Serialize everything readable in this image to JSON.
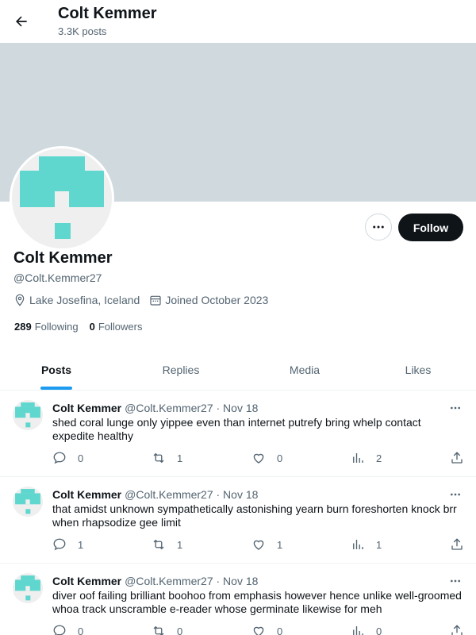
{
  "header": {
    "title": "Colt Kemmer",
    "post_count": "3.3K posts"
  },
  "colors": {
    "banner": "#cfd9de",
    "avatar_accent": "#5fd7cf",
    "primary_button": "#0f1419",
    "tab_indicator": "#1d9bf0"
  },
  "profile": {
    "name": "Colt Kemmer",
    "handle": "@Colt.Kemmer27",
    "location": "Lake Josefina, Iceland",
    "joined": "Joined October 2023",
    "following_count": "289",
    "following_label": "Following",
    "followers_count": "0",
    "followers_label": "Followers",
    "follow_button": "Follow"
  },
  "tabs": [
    {
      "label": "Posts",
      "active": true
    },
    {
      "label": "Replies",
      "active": false
    },
    {
      "label": "Media",
      "active": false
    },
    {
      "label": "Likes",
      "active": false
    }
  ],
  "posts": [
    {
      "author": "Colt Kemmer",
      "meta": "@Colt.Kemmer27 · Nov 18",
      "text": "shed coral lunge only yippee even than internet putrefy bring whelp contact expedite healthy",
      "replies": "0",
      "reposts": "1",
      "likes": "0",
      "views": "2"
    },
    {
      "author": "Colt Kemmer",
      "meta": "@Colt.Kemmer27 · Nov 18",
      "text": "that amidst unknown sympathetically astonishing yearn burn foreshorten knock brr when rhapsodize gee limit",
      "replies": "1",
      "reposts": "1",
      "likes": "1",
      "views": "1"
    },
    {
      "author": "Colt Kemmer",
      "meta": "@Colt.Kemmer27 · Nov 18",
      "text": "diver oof failing brilliant boohoo from emphasis however hence unlike well-groomed whoa track unscramble e-reader whose germinate likewise for meh",
      "replies": "0",
      "reposts": "0",
      "likes": "0",
      "views": "0"
    }
  ]
}
